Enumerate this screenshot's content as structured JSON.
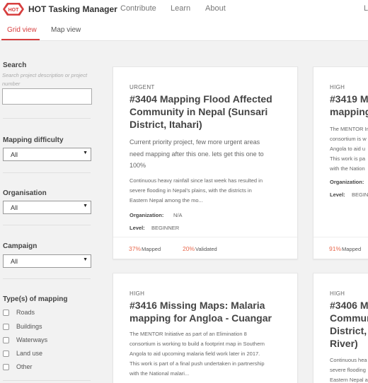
{
  "header": {
    "app_name": "HOT Tasking Manager",
    "logo_text": "HOT",
    "nav": [
      "Contribute",
      "Learn",
      "About"
    ],
    "right_text": "L"
  },
  "tabs": [
    "Grid view",
    "Map view"
  ],
  "sidebar": {
    "search_label": "Search",
    "search_hint": "Search project description or project number",
    "search_value": "",
    "difficulty_label": "Mapping difficulty",
    "difficulty_value": "All",
    "organisation_label": "Organisation",
    "organisation_value": "All",
    "campaign_label": "Campaign",
    "campaign_value": "All",
    "types_label": "Type(s) of mapping",
    "types": [
      "Roads",
      "Buildings",
      "Waterways",
      "Land use",
      "Other"
    ]
  },
  "projects": [
    {
      "priority": "URGENT",
      "title_lines": [
        "#3404 Mapping Flood Affected",
        "Community in Nepal (Sunsari",
        "District, Itahari)"
      ],
      "subtitle_lines": [
        "Current priority project, few more urgent areas",
        "need mapping after this one. lets get this one to",
        "100%"
      ],
      "desc_lines": [
        "Continuous heavy rainfall since last week has resulted in",
        "severe flooding in Nepal's plains, with the districts in",
        "Eastern Nepal among the mo..."
      ],
      "org_label": "Organization:",
      "org": "N/A",
      "level_label": "Level:",
      "level": "BEGINNER",
      "mapped_pct": "37%",
      "mapped_label": "Mapped",
      "validated_pct": "20%",
      "validated_label": "Validated"
    },
    {
      "priority": "HIGH",
      "title_lines": [
        "#3419 M",
        "mapping"
      ],
      "desc_lines": [
        "The MENTOR In",
        "consortium is w",
        "Angola to aid u",
        "This work is pa",
        "with the Nation"
      ],
      "org_label": "Organization:",
      "level_label": "Level:",
      "level": "BEGIN",
      "mapped_pct": "91%",
      "mapped_label": "Mapped"
    },
    {
      "priority": "HIGH",
      "title_lines": [
        "#3416 Missing Maps: Malaria",
        "mapping for Angloa - Cuangar"
      ],
      "desc_lines": [
        "The MENTOR Initiative as part of an Elimination 8",
        "consortium is working to build a footprint map in Southern",
        "Angola to aid upcoming malaria field work later in 2017.",
        "This work is part of a final push undertaken in partnership",
        "with the National malari..."
      ]
    },
    {
      "priority": "HIGH",
      "title_lines": [
        "#3406 M",
        "Commun",
        "District,",
        "River)"
      ],
      "desc_lines": [
        "Continuous hea",
        "severe flooding",
        "Eastern Nepal a"
      ]
    }
  ]
}
